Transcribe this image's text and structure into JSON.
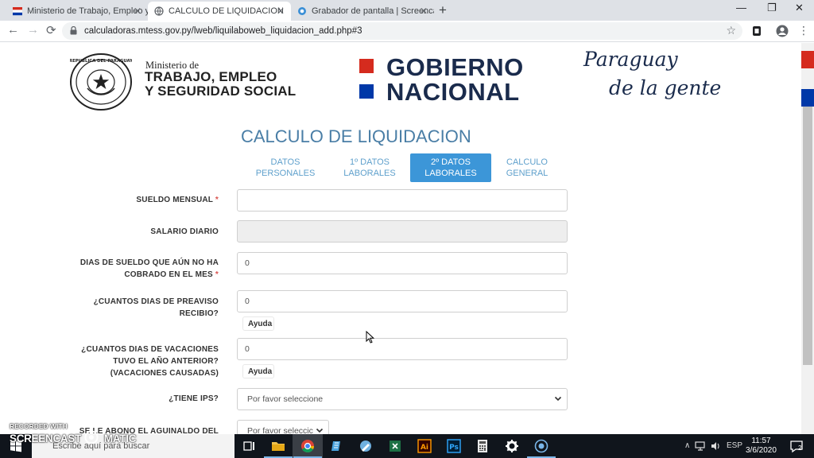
{
  "browser": {
    "tabs": [
      {
        "title": "Ministerio de Trabajo, Empleo y S",
        "active": false
      },
      {
        "title": "CALCULO DE LIQUIDACION",
        "active": true
      },
      {
        "title": "Grabador de pantalla | Screencas",
        "active": false
      }
    ],
    "url": "calculadoras.mtess.gov.py/lweb/liquilaboweb_liquidacion_add.php#3"
  },
  "header": {
    "ministry_small": "Ministerio de",
    "ministry_line1": "TRABAJO, EMPLEO",
    "ministry_line2": "Y SEGURIDAD SOCIAL",
    "gob_line1": "GOBIERNO",
    "gob_line2": "NACIONAL",
    "slogan_line1": "Paraguay",
    "slogan_line2": "de la gente",
    "seal_text": "REPUBLICA DEL PARAGUAY"
  },
  "page_title": "CALCULO DE LIQUIDACION",
  "steps": [
    {
      "line1": "DATOS",
      "line2": "PERSONALES"
    },
    {
      "line1": "1º DATOS",
      "line2": "LABORALES"
    },
    {
      "line1": "2º DATOS",
      "line2": "LABORALES"
    },
    {
      "line1": "CALCULO",
      "line2": "GENERAL"
    }
  ],
  "form": {
    "sueldo_label": "SUELDO MENSUAL",
    "sueldo_value": "",
    "salario_label": "SALARIO DIARIO",
    "salario_value": "",
    "dias_sueldo_label1": "DIAS DE SUELDO QUE AÚN NO HA",
    "dias_sueldo_label2": "COBRADO EN EL MES",
    "dias_sueldo_value": "0",
    "preaviso_label1": "¿CUANTOS DIAS DE PREAVISO",
    "preaviso_label2": "RECIBIO?",
    "preaviso_value": "0",
    "ayuda_label": "Ayuda",
    "vacaciones_label1": "¿CUANTOS DIAS DE VACACIONES",
    "vacaciones_label2": "TUVO EL AÑO ANTERIOR?",
    "vacaciones_label3": "(VACACIONES CAUSADAS)",
    "vacaciones_value": "0",
    "ips_label": "¿TIENE IPS?",
    "ips_value": "Por favor seleccione",
    "aguinaldo_label": "SE LE ABONO EL AGUINALDO DEL",
    "aguinaldo_value": "Por favor seleccic",
    "required_mark": "*"
  },
  "taskbar": {
    "search_placeholder": "Escribe aquí para buscar",
    "lang": "ESP",
    "time": "11:57",
    "date": "3/6/2020",
    "notifications": "2"
  },
  "watermark": {
    "recorded": "RECORDED WITH",
    "brand_left": "SCREENCAST",
    "brand_right": "MATIC"
  }
}
